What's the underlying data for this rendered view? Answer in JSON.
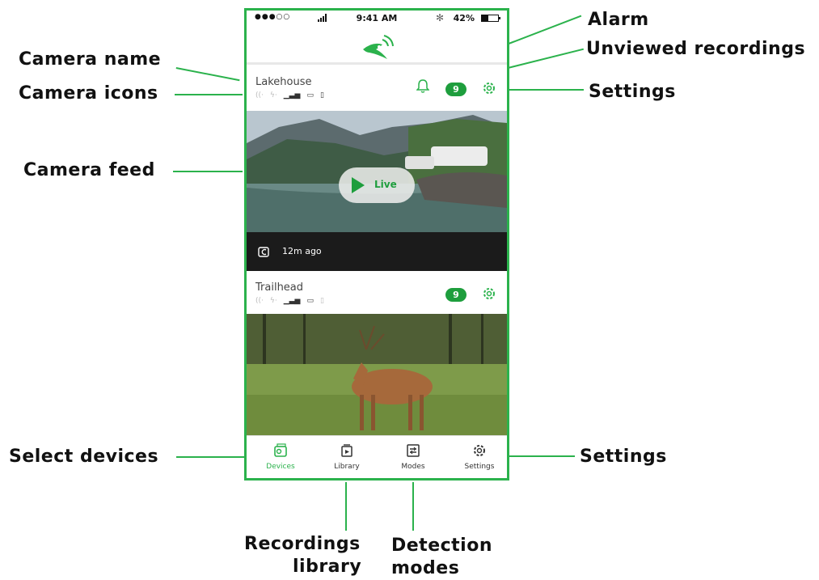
{
  "callouts": {
    "camera_name": "Camera name",
    "camera_icons": "Camera icons",
    "camera_feed": "Camera feed",
    "alarm": "Alarm",
    "unviewed_recordings": "Unviewed recordings",
    "settings_top": "Settings",
    "select_devices": "Select devices",
    "settings_bottom": "Settings",
    "recordings_library_line1": "Recordings",
    "recordings_library_line2": "library",
    "detection_modes_line1": "Detection",
    "detection_modes_line2": "modes"
  },
  "status_bar": {
    "carrier": "●●●○○",
    "time": "9:41 AM",
    "bluetooth": "✻",
    "battery": "42%"
  },
  "cameras": [
    {
      "name": "Lakehouse",
      "unviewed_count": "9",
      "live_label": "Live",
      "last_update": "12m ago",
      "has_alarm": true
    },
    {
      "name": "Trailhead",
      "unviewed_count": "9",
      "has_alarm": false
    }
  ],
  "tabs": [
    {
      "label": "Devices",
      "icon": "devices-icon",
      "active": true
    },
    {
      "label": "Library",
      "icon": "library-icon",
      "active": false
    },
    {
      "label": "Modes",
      "icon": "modes-icon",
      "active": false
    },
    {
      "label": "Settings",
      "icon": "settings-icon",
      "active": false
    }
  ],
  "colors": {
    "accent": "#2bb24c",
    "badge": "#1e9e3d",
    "feed_overlay": "#1b1b1b"
  }
}
